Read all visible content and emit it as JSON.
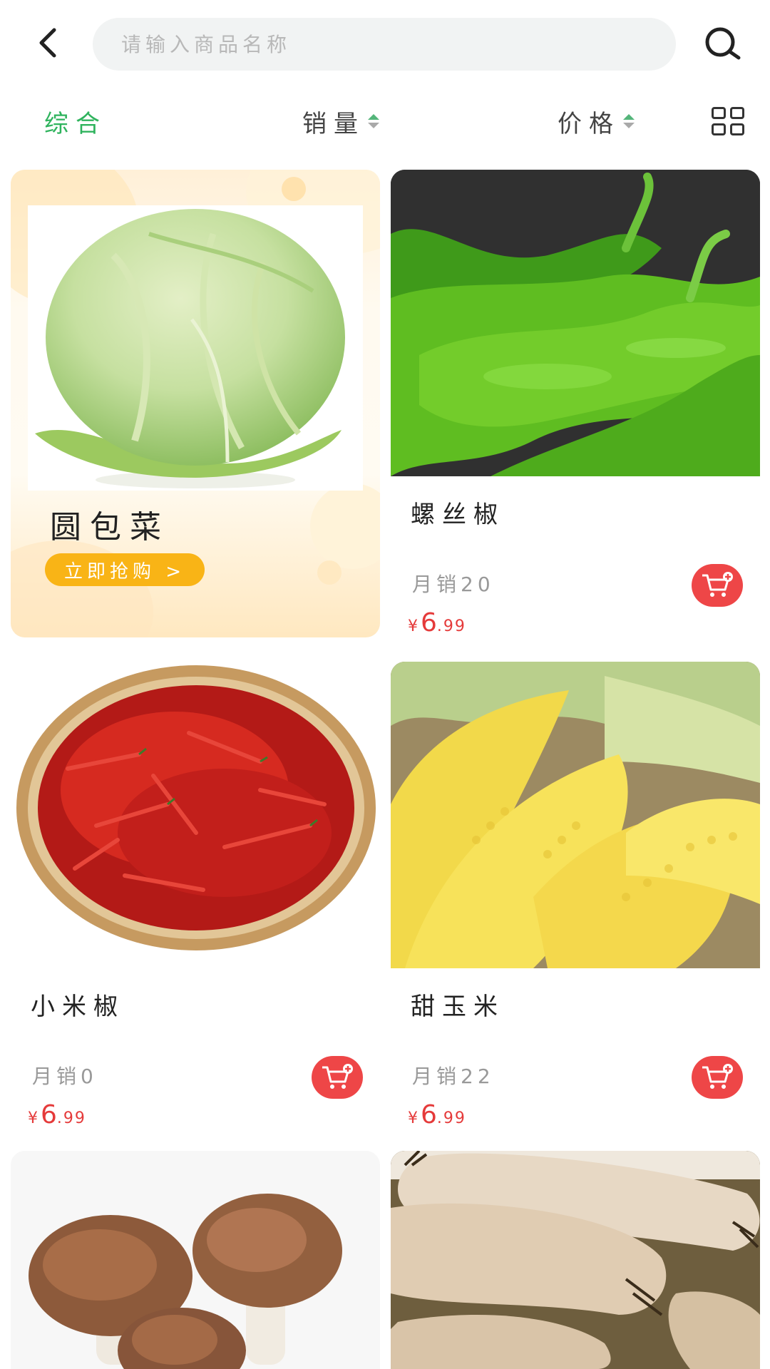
{
  "search": {
    "placeholder": "请输入商品名称"
  },
  "filters": {
    "comprehensive": "综合",
    "sales": "销量",
    "price": "价格"
  },
  "colors": {
    "accent_green": "#2fb35d",
    "price_red": "#e53a3a",
    "promo_yellow": "#f9b416",
    "cart_red": "#ee4647"
  },
  "promo": {
    "title": "圆包菜",
    "button": "立即抢购 >"
  },
  "products": [
    {
      "name": "螺丝椒",
      "sales": "月销20",
      "price_symbol": "¥",
      "price_int": "6",
      "price_dec": ".99"
    },
    {
      "name": "小米椒",
      "sales": "月销0",
      "price_symbol": "¥",
      "price_int": "6",
      "price_dec": ".99"
    },
    {
      "name": "甜玉米",
      "sales": "月销22",
      "price_symbol": "¥",
      "price_int": "6",
      "price_dec": ".99"
    }
  ],
  "icons": {
    "back": "chevron-left-icon",
    "search": "search-icon",
    "layout": "grid-view-icon",
    "cart": "cart-add-icon"
  }
}
